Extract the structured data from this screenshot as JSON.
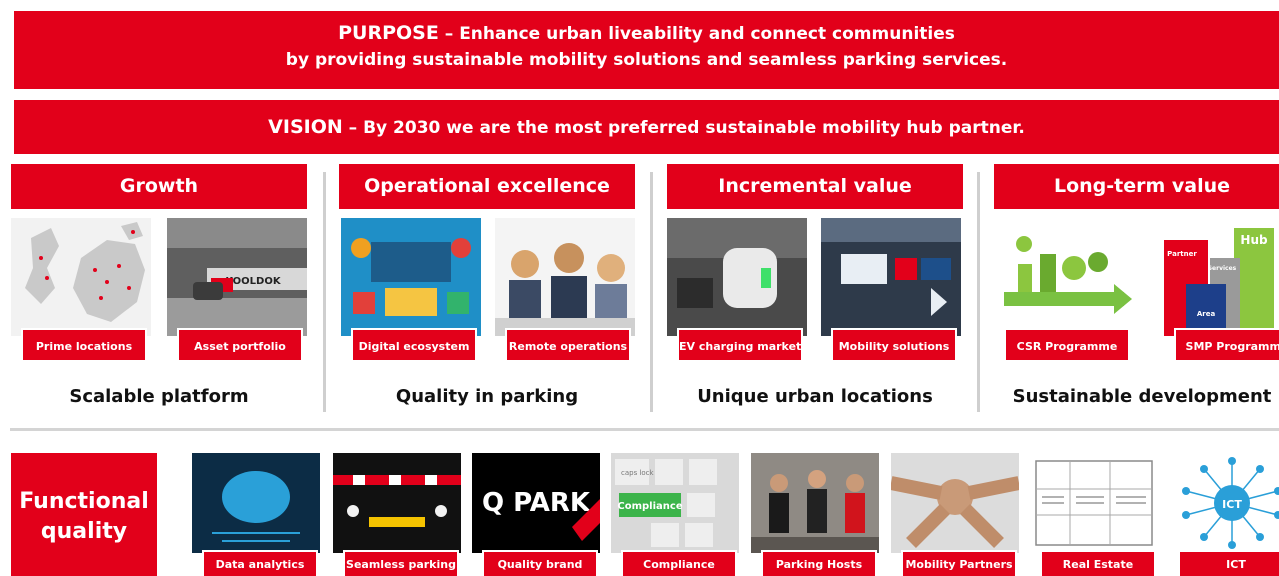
{
  "purpose": {
    "keyword": "PURPOSE",
    "line1": " – Enhance urban liveability and connect communities",
    "line2": "by providing sustainable mobility solutions and seamless parking services."
  },
  "vision": {
    "keyword": "VISION",
    "text": " – By 2030 we are the most preferred sustainable mobility hub partner."
  },
  "pillars": [
    {
      "title": "Growth",
      "tiles": [
        "Prime locations",
        "Asset portfolio"
      ],
      "footer": "Scalable platform"
    },
    {
      "title": "Operational excellence",
      "tiles": [
        "Digital ecosystem",
        "Remote operations"
      ],
      "footer": "Quality in parking"
    },
    {
      "title": "Incremental value",
      "tiles": [
        "EV charging market",
        "Mobility solutions"
      ],
      "footer": "Unique urban locations"
    },
    {
      "title": "Long-term value",
      "tiles": [
        "CSR Programme",
        "SMP Programme"
      ],
      "footer": "Sustainable development"
    }
  ],
  "image_text": {
    "kooldok": "KOOLDOK",
    "qpark": "Q PARK",
    "compliance": "Compliance",
    "caps_lock": "caps lock",
    "hub": "Hub",
    "partner": "Partner",
    "services": "Services",
    "area": "Area",
    "ict": "ICT"
  },
  "functional": {
    "label_line1": "Functional",
    "label_line2": "quality",
    "items": [
      "Data analytics",
      "Seamless parking",
      "Quality brand",
      "Compliance",
      "Parking Hosts",
      "Mobility Partners",
      "Real Estate",
      "ICT"
    ]
  },
  "colors": {
    "brand_red": "#e2001a",
    "divider": "#cfcfcf"
  }
}
